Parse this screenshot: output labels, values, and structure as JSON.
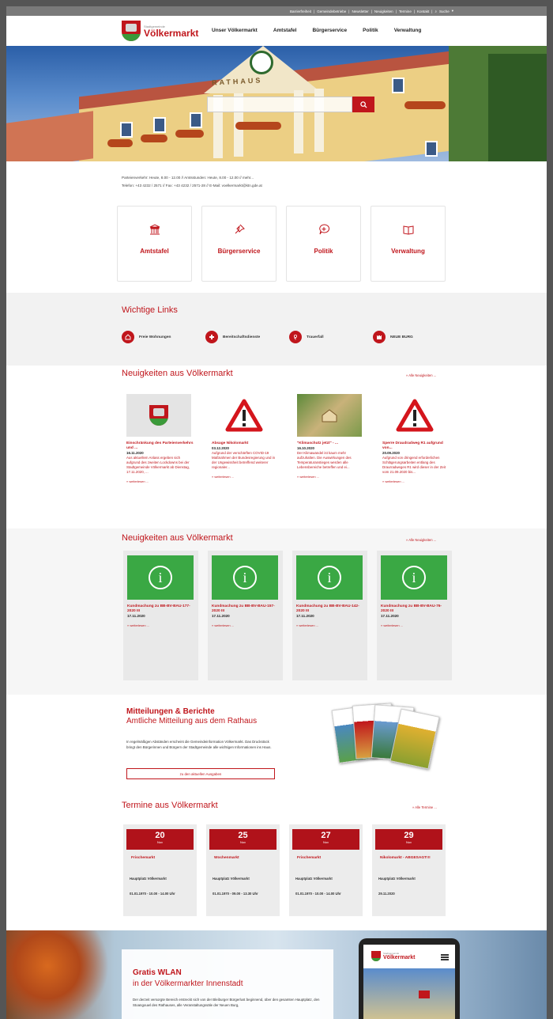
{
  "topbar": {
    "links": [
      "Barrierfreiheit",
      "Gemeindebetriebe",
      "Newsletter",
      "Neuigkeiten",
      "Termine",
      "Kontakt",
      "Suche"
    ]
  },
  "logo": {
    "small": "Stadtgemeinde",
    "big": "Völkermarkt"
  },
  "nav": [
    "Unser Völkermarkt",
    "Amtstafel",
    "Bürgerservice",
    "Politik",
    "Verwaltung"
  ],
  "hero": {
    "building_sign": "RATHAUS",
    "search_placeholder": ""
  },
  "info": {
    "line1": "Parteienverkehr: Heute, 8.00 - 12.00 // Amtsstunden: Heute, 8.00 - 12.00 // mehr...",
    "line2": "Telefon: +43 4232 / 2571 // Fax: +43 4232 / 2571-28 // E-Mail: voelkermarkt@ktn.gde.at"
  },
  "quick_cards": [
    {
      "label": "Amtstafel",
      "icon": "columns-icon"
    },
    {
      "label": "Bürgerservice",
      "icon": "pin-icon"
    },
    {
      "label": "Politik",
      "icon": "speech-plus-icon"
    },
    {
      "label": "Verwaltung",
      "icon": "book-icon"
    }
  ],
  "wichtige_links": {
    "title": "Wichtige Links",
    "items": [
      {
        "label": "Freie Wohnungen",
        "icon": "home-icon"
      },
      {
        "label": "Bereitschaftsdienste",
        "icon": "medical-icon"
      },
      {
        "label": "Trauerfall",
        "icon": "flower-icon"
      },
      {
        "label": "NEUE BURG",
        "icon": "castle-icon"
      }
    ]
  },
  "news1": {
    "title": "Neuigkeiten aus Völkermarkt",
    "more": "» Alle Neuigkeiten ...",
    "items": [
      {
        "title": "Einschränkung des Parteienverkehrs und ...",
        "date": "16.11.2020",
        "text": "Aus aktuellem Anlass ergeben sich aufgrund des zweiten Lockdowns bei der Stadtgemeinde Völkermarkt ab Dienstag, 17.11.2020, ...",
        "more": "» weiterlesen ...",
        "image": "crest"
      },
      {
        "title": "Absage Nikolomarkt",
        "date": "03.12.2020",
        "text": "Aufgrund der verschärften COVID-19 Maßnahmen der Bundesregierung und in der Ungewissheit betreffend weiterer regionaler...",
        "more": "» weiterlesen ...",
        "image": "warning"
      },
      {
        "title": "\"Klimaschutz jetzt\" - ...",
        "date": "16.10.2020",
        "text": "Der Klimawandel ist kaum mehr aufzuhalten. Die Auswirkungen des Temperaturanstieges werden alle Lebensbereiche betreffen und ei...",
        "more": "» weiterlesen ...",
        "image": "photo"
      },
      {
        "title": "Sperre Draudradweg R1 aufgrund von...",
        "date": "20.09.2020",
        "text": "Aufgrund von dringend erforderlichen Schlägerungsarbeiten entlang des Draurradweges R1 wird dieser in der Zeit vom 21.09.2020 bis...",
        "more": "» weiterlesen ...",
        "image": "warning"
      }
    ]
  },
  "news2": {
    "title": "Neuigkeiten aus Völkermarkt",
    "more": "» Alle Neuigkeiten ...",
    "items": [
      {
        "title": "Kundmachung zu BB-BV-BAU-177-2020 III",
        "date": "17.11.2020",
        "more": "» weiterlesen ..."
      },
      {
        "title": "Kundmachung zu BB-BV-BAU-157-2020 III",
        "date": "17.11.2020",
        "more": "» weiterlesen ..."
      },
      {
        "title": "Kundmachung zu BB-BV-BAU-142-2020 III",
        "date": "17.11.2020",
        "more": "» weiterlesen ..."
      },
      {
        "title": "Kundmachung zu BB-BV-BAU-76-2020 III",
        "date": "17.11.2020",
        "more": "» weiterlesen ..."
      }
    ]
  },
  "mitteilungen": {
    "title": "Mitteilungen & Berichte",
    "subtitle": "Amtliche Mitteilung aus dem Rathaus",
    "text": "In regelmäßigen Abständen erscheint die Gemeindeinformation Völkermarkt. Das Druckstück bringt den Bürgerinnen und Bürgern der Stadtgemeinde alle wichtigen Informationen ins Haus.",
    "button": "zu den aktuellen Ausgaben"
  },
  "termine": {
    "title": "Termine aus Völkermarkt",
    "more": "» Alle Termine ...",
    "items": [
      {
        "day": "20",
        "month": "Nov",
        "name": "Frischemarkt",
        "location": "Hauptplatz Völkermarkt",
        "time": "01.01.1970 - 10.00 - 14.00 Uhr"
      },
      {
        "day": "25",
        "month": "Nov",
        "name": "Wochenmarkt",
        "location": "Hauptplatz Völkermarkt",
        "time": "01.01.1970 - 09.00 - 13.30 Uhr"
      },
      {
        "day": "27",
        "month": "Nov",
        "name": "Frischemarkt",
        "location": "Hauptplatz Völkermarkt",
        "time": "01.01.1970 - 10.00 - 14.00 Uhr"
      },
      {
        "day": "29",
        "month": "Nov",
        "name": "Nikolomarkt - ABGESAGT!!!",
        "location": "Hauptplatz Völkermarkt",
        "time": "29.11.2020"
      }
    ]
  },
  "wlan": {
    "title1": "Gratis WLAN",
    "title2": "in der Völkermarkter Innenstadt",
    "text": "Der derzeit versorgte Bereich erstreckt sich von der Bleiburger Bürgerlust beginnend, über den gesamten Hauptplatz, den Stoangouwl des Rathauses, alle Veranstaltungssäle der Neuen Burg,"
  },
  "colors": {
    "accent": "#c0161c",
    "green": "#3aa844",
    "gray_bg": "#f2f2f2"
  }
}
